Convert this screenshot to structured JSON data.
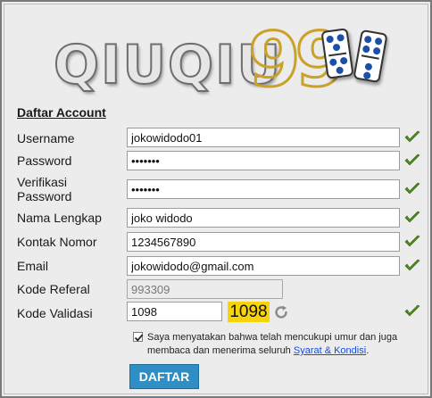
{
  "brand": {
    "logo_text": "QIUQIU",
    "logo_number": "99"
  },
  "form": {
    "heading": "Daftar Account",
    "fields": {
      "username": {
        "label": "Username",
        "value": "jokowidodo01"
      },
      "password": {
        "label": "Password",
        "value": "•••••••"
      },
      "verify_password": {
        "label_line1": "Verifikasi",
        "label_line2": "Password",
        "value": "•••••••"
      },
      "full_name": {
        "label": "Nama Lengkap",
        "value": "joko widodo"
      },
      "phone": {
        "label": "Kontak Nomor",
        "value": "1234567890"
      },
      "email": {
        "label": "Email",
        "value": "jokowidodo@gmail.com"
      },
      "referral": {
        "label": "Kode Referal",
        "value": "993309"
      },
      "validation": {
        "label": "Kode Validasi",
        "value": "1098",
        "captcha_code": "1098"
      }
    },
    "agreement": {
      "checked": true,
      "text_before": "Saya menyatakan bahwa telah mencukupi umur dan juga membaca dan menerima seluruh ",
      "link_text": "Syarat & Kondisi",
      "text_after": "."
    },
    "submit_label": "DAFTAR"
  },
  "icons": {
    "valid": "checkmark-icon",
    "refresh": "refresh-icon"
  },
  "colors": {
    "check_green": "#4f8a1c",
    "button_blue": "#2f8ec4",
    "captcha_yellow": "#f7d30a",
    "link_blue": "#1a4bd6"
  }
}
